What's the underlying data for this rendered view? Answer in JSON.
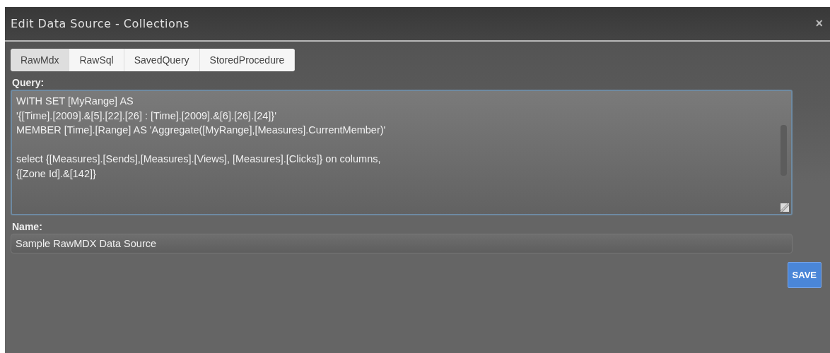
{
  "window": {
    "title": "Edit Data Source - Collections",
    "close": "×"
  },
  "tabs": [
    {
      "label": "RawMdx",
      "selected": true
    },
    {
      "label": "RawSql",
      "selected": false
    },
    {
      "label": "SavedQuery",
      "selected": false
    },
    {
      "label": "StoredProcedure",
      "selected": false
    }
  ],
  "query": {
    "label": "Query:",
    "blocks": [
      [
        "WITH SET [MyRange] AS",
        "'{[Time].[2009].&[5].[22].[26] : [Time].[2009].&[6].[26].[24]}'",
        "MEMBER [Time].[Range] AS 'Aggregate([MyRange],[Measures].CurrentMember)'"
      ],
      [
        "select {[Measures].[Sends],[Measures].[Views], [Measures].[Clicks]} on columns,",
        "{[Zone Id].&[142]}"
      ]
    ]
  },
  "name": {
    "label": "Name:",
    "value": "Sample RawMDX Data Source"
  },
  "buttons": [
    {
      "label": "SAVE"
    }
  ]
}
